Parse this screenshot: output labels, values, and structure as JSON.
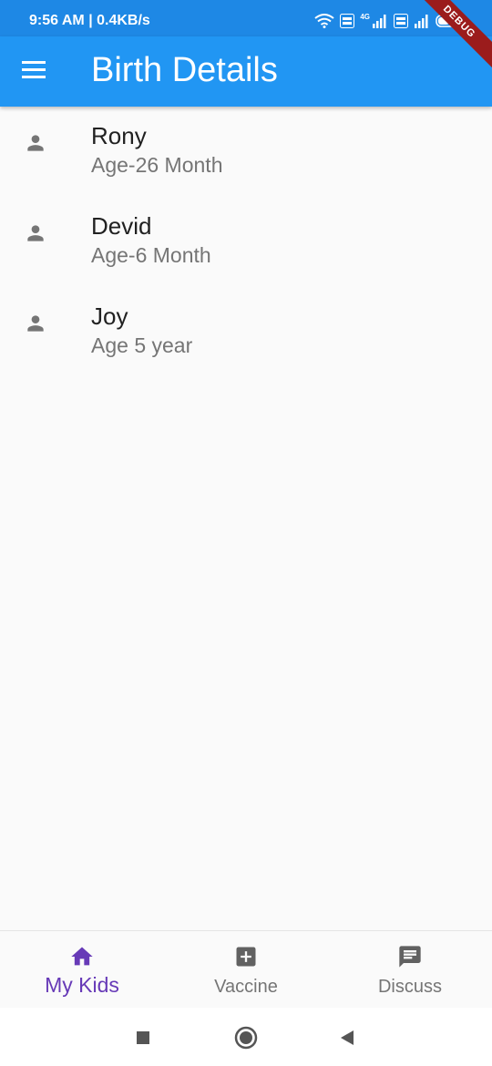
{
  "status_bar": {
    "time": "9:56 AM | 0.4KB/s",
    "network_label": "4G",
    "debug_label": "DEBUG"
  },
  "app_bar": {
    "title": "Birth Details",
    "menu_icon": "menu-icon"
  },
  "kids": [
    {
      "name": "Rony",
      "age": "Age-26 Month",
      "icon": "person-icon"
    },
    {
      "name": "Devid",
      "age": "Age-6 Month",
      "icon": "person-icon"
    },
    {
      "name": "Joy",
      "age": "Age 5 year",
      "icon": "person-icon"
    }
  ],
  "bottom_nav": {
    "items": [
      {
        "label": "My Kids",
        "icon": "home-icon",
        "active": true
      },
      {
        "label": "Vaccine",
        "icon": "medical-plus-icon",
        "active": false
      },
      {
        "label": "Discuss",
        "icon": "chat-icon",
        "active": false
      }
    ]
  },
  "colors": {
    "status_bar": "#1e88e5",
    "app_bar": "#2196f3",
    "active_nav": "#673ab7",
    "inactive_nav": "#757575"
  }
}
